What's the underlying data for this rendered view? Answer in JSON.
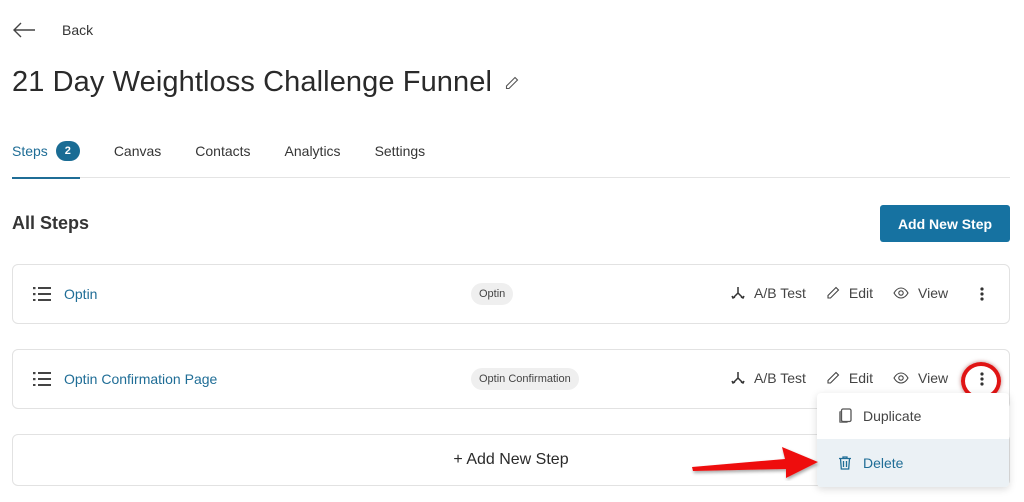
{
  "header": {
    "back_label": "Back",
    "title": "21 Day Weightloss Challenge Funnel"
  },
  "tabs": [
    {
      "label": "Steps",
      "badge": "2",
      "active": true
    },
    {
      "label": "Canvas"
    },
    {
      "label": "Contacts"
    },
    {
      "label": "Analytics"
    },
    {
      "label": "Settings"
    }
  ],
  "section": {
    "title": "All Steps",
    "add_button": "Add New Step"
  },
  "steps": [
    {
      "name": "Optin",
      "type": "Optin",
      "actions": {
        "ab": "A/B Test",
        "edit": "Edit",
        "view": "View"
      }
    },
    {
      "name": "Optin Confirmation Page",
      "type": "Optin Confirmation",
      "actions": {
        "ab": "A/B Test",
        "edit": "Edit",
        "view": "View"
      }
    }
  ],
  "add_row_label": "+ Add New Step",
  "context_menu": {
    "items": [
      {
        "label": "Duplicate",
        "icon": "copy-icon"
      },
      {
        "label": "Delete",
        "icon": "trash-icon",
        "hovered": true
      }
    ]
  },
  "colors": {
    "accent": "#1672a1",
    "link": "#1f6d96",
    "annotation": "#e01414"
  }
}
